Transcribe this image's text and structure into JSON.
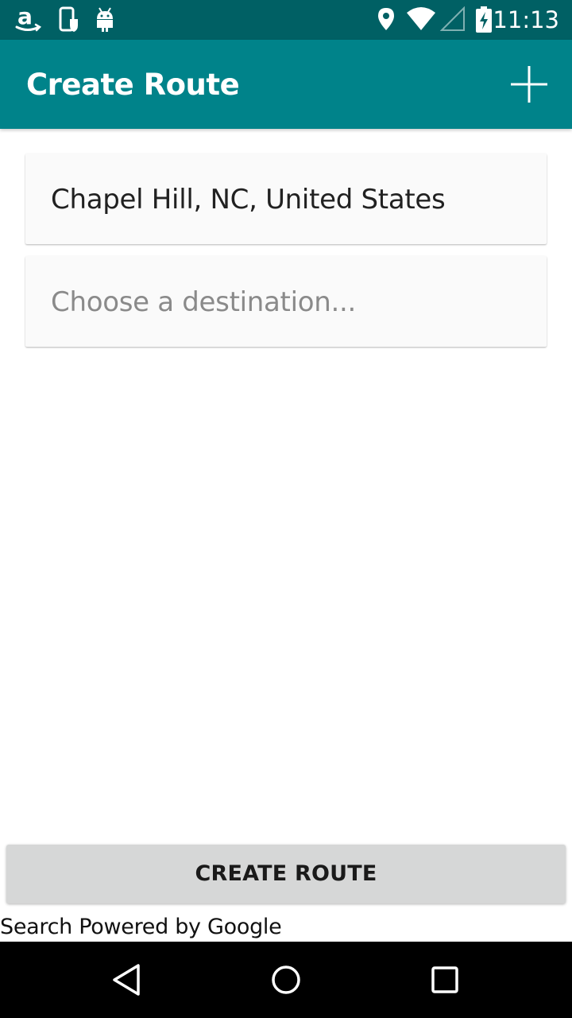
{
  "status_bar": {
    "time": "11:13",
    "icons": [
      "amazon-icon",
      "phone-shield-icon",
      "android-icon",
      "location-icon",
      "wifi-icon",
      "signal-icon",
      "battery-charging-icon"
    ]
  },
  "app_bar": {
    "title": "Create Route",
    "action_icon": "plus-icon"
  },
  "form": {
    "origin_value": "Chapel Hill, NC, United States",
    "destination_placeholder": "Choose a destination..."
  },
  "create_button": {
    "label": "CREATE ROUTE"
  },
  "footer": {
    "attribution": "Search Powered by Google"
  },
  "nav_bar": {
    "icons": [
      "back-icon",
      "home-icon",
      "recents-icon"
    ]
  },
  "colors": {
    "status_bar": "#006064",
    "app_bar": "#00838a",
    "button": "#d6d7d7"
  }
}
